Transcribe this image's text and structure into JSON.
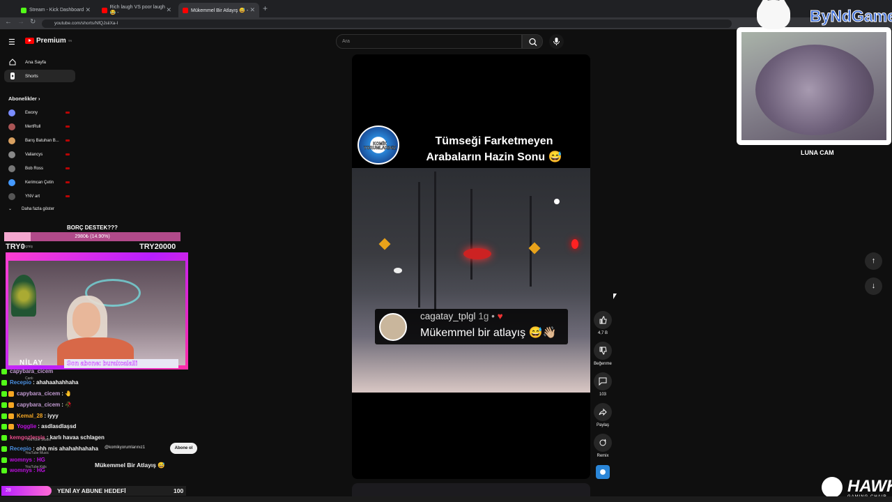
{
  "browser": {
    "tabs": [
      {
        "title": "Stream - Kick Dashboard",
        "color": "#53fc18"
      },
      {
        "title": "Rich laugh VS poor laugh 😂 -",
        "color": "#ff0000"
      },
      {
        "title": "Mükemmel Bir Atlayış 😅 -",
        "color": "#ff0000"
      }
    ],
    "url": "youtube.com/shorts/NfQJsiiXa-I"
  },
  "youtube": {
    "logo": "Premium",
    "logo_sup": "TR",
    "search_placeholder": "Ara",
    "nav": [
      {
        "label": "Ana Sayfa",
        "icon": "home-icon"
      },
      {
        "label": "Shorts",
        "icon": "shorts-icon"
      }
    ],
    "subscriptions_title": "Abonelikler",
    "subscriptions": [
      {
        "name": "Ewony",
        "color": "#7a8cff"
      },
      {
        "name": "MertRull",
        "color": "#a55"
      },
      {
        "name": "Barış Batuhan B...",
        "color": "#d8a060"
      },
      {
        "name": "Valiancys",
        "color": "#888"
      },
      {
        "name": "Bob Ross",
        "color": "#777"
      },
      {
        "name": "Kerimcan Çetin",
        "color": "#49f"
      },
      {
        "name": "YNV art",
        "color": "#555"
      }
    ],
    "show_more": "Daha fazla göster",
    "actions": {
      "like_count": "4,7 B",
      "dislike_label": "Beğenme",
      "comment_count": "103",
      "share_label": "Paylaş",
      "remix_label": "Remix"
    },
    "popup_title": "Mükemmel Bir Atlayış 😅",
    "subscribe_button": "Abone ol"
  },
  "video": {
    "badge": "KOMİK YORUMLARINIZ",
    "headline_line1": "Tümseği Farketmeyen",
    "headline_line2": "Arabaların Hazin Sonu 😅",
    "comment_user": "cagatay_tplgl",
    "comment_time": "1g •",
    "comment_text": "Mükemmel bir atlayış 😅👋🏼"
  },
  "overlay": {
    "donation_title": "BORÇ DESTEK???",
    "donation_progress": "2980₺ (14.90%)",
    "donation_progress_fraction": 0.149,
    "donation_min": "TRY0",
    "donation_max": "TRY20000",
    "donation_ghost": "Geçmiş",
    "streamer_name": "NİLAY",
    "last_sub_label": "Son abone: burakcalalli",
    "goal_left": "28",
    "goal_title": "YENİ AY ABUNE HEDEFİ",
    "goal_target": "100",
    "ghost_canli": "Canlı",
    "luna_cam": "LUNA CAM",
    "brand": "ByNdGames",
    "hawk": "HAWK",
    "hawk_sub": "GAMING CHAIR",
    "yt_links": [
      "YouTube Studio",
      "YouTube Music",
      "YouTube Kids"
    ],
    "channel_mention": "@komikyorumlarınız1"
  },
  "chat": [
    {
      "user": "capybara_cicem",
      "msg": "",
      "color": "#c39bd3"
    },
    {
      "user": "Recepio",
      "msg": ": ahahaahahhaha",
      "color": "#4a90e2"
    },
    {
      "user": "capybara_cicem",
      "msg": ": 🤚",
      "color": "#c39bd3"
    },
    {
      "user": "capybara_cicem",
      "msg": ": 🥀",
      "color": "#c39bd3"
    },
    {
      "user": "Kemal_28",
      "msg": ": iyyy",
      "color": "#f5a623"
    },
    {
      "user": "Yogglie",
      "msg": ": asdlasdlaşsd",
      "color": "#bd10e0"
    },
    {
      "user": "kemgozlersis",
      "msg": ": karlı havaa schlagen",
      "color": "#e94b8a"
    },
    {
      "user": "Recepio",
      "msg": ": ohh mis ahahahhahaha",
      "color": "#4a90e2"
    },
    {
      "user": "womnys",
      "msg": ": HG",
      "color": "#bd10e0"
    },
    {
      "user": "womnys",
      "msg": ": HG",
      "color": "#bd10e0"
    }
  ]
}
